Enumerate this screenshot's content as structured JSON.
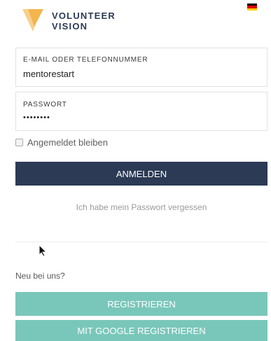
{
  "brand": {
    "name_line1": "VOLUNTEER",
    "name_line2": "VISION",
    "accent": "#f3b54d",
    "text_color": "#2b3a55"
  },
  "locale": {
    "flag_icon": "germany-flag-icon",
    "flag_colors": [
      "#000000",
      "#dd0000",
      "#ffce00"
    ]
  },
  "login": {
    "identifier_label": "E-MAIL ODER TELEFONNUMMER",
    "identifier_value": "mentorestart",
    "password_label": "PASSWORT",
    "password_value": "••••••••",
    "remember_label": "Angemeldet bleiben",
    "remember_checked": false,
    "submit_label": "ANMELDEN",
    "submit_color": "#2c3a55",
    "forgot_link": "Ich habe mein Passwort vergessen"
  },
  "register": {
    "prompt": "Neu bei uns?",
    "register_label": "REGISTRIEREN",
    "google_label": "MIT GOOGLE REGISTRIEREN",
    "button_color": "#79c7ba"
  }
}
